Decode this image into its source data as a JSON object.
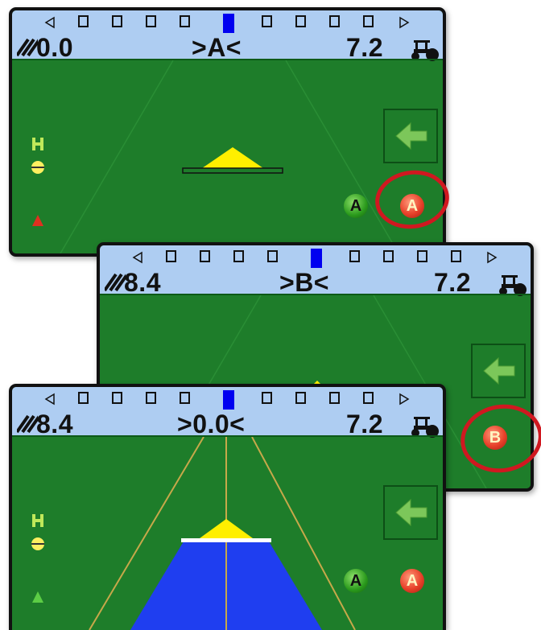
{
  "panels": [
    {
      "left_value": "0.0",
      "center_text": ">A<",
      "right_value": "7.2",
      "buttons": [
        "A",
        "A"
      ],
      "highlighted_button": "A"
    },
    {
      "left_value": "8.4",
      "center_text": ">B<",
      "right_value": "7.2",
      "buttons": [
        "B"
      ],
      "highlighted_button": "B"
    },
    {
      "left_value": "8.4",
      "center_text": ">0.0<",
      "right_value": "7.2",
      "buttons": [
        "A",
        "A"
      ]
    }
  ],
  "colors": {
    "field_green": "#1e7d2a",
    "lightbar_blue": "#aecdf2",
    "center_led": "#0000f0",
    "guidance_blue": "#1f3ef0",
    "highlight_red": "#d01820",
    "vehicle_yellow": "#ffef00"
  },
  "icons": [
    "left-arrow-icon",
    "right-arrow-icon",
    "hatch-icon",
    "tractor-icon",
    "return-arrow-icon",
    "boom-icon",
    "vehicle-triangle-icon"
  ]
}
